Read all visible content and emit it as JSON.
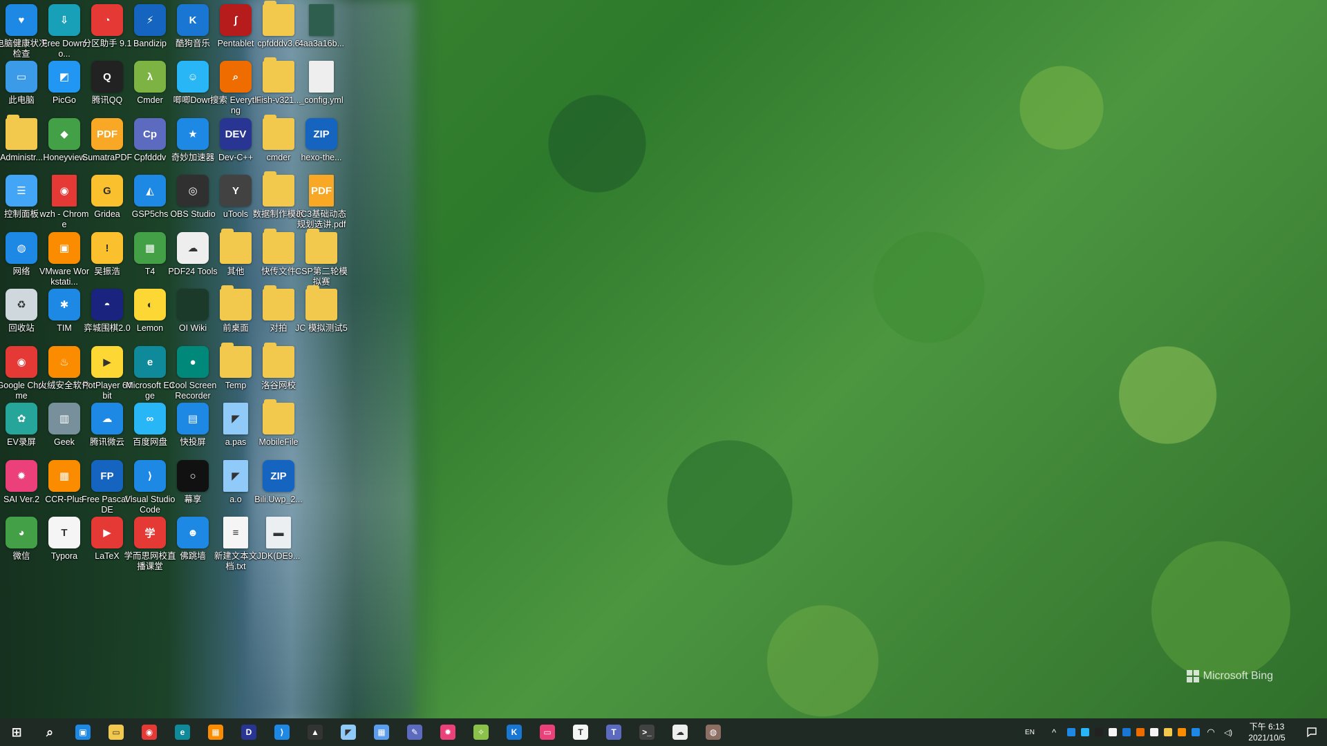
{
  "desktop": {
    "icons": [
      {
        "label": "电脑健康状况检查",
        "icon": "heart-health-icon",
        "color": "#1e88e5",
        "glyph": "♥"
      },
      {
        "label": "Free Downlo...",
        "icon": "download-manager-icon",
        "color": "#18a0b8",
        "glyph": "⇩"
      },
      {
        "label": "分区助手 9.1",
        "icon": "partition-assistant-icon",
        "color": "#e53935",
        "glyph": "◔"
      },
      {
        "label": "Bandizip",
        "icon": "bandizip-icon",
        "color": "#1565c0",
        "glyph": "⚡"
      },
      {
        "label": "酷狗音乐",
        "icon": "kugou-music-icon",
        "color": "#1976d2",
        "glyph": "K"
      },
      {
        "label": "Pentablet",
        "icon": "pentablet-icon",
        "color": "#b71c1c",
        "glyph": "∫"
      },
      {
        "label": "cpfdddv3.6",
        "icon": "folder-icon",
        "color": "#f2c94c",
        "glyph": ""
      },
      {
        "label": "4aa3a16b...",
        "icon": "image-file-icon",
        "color": "#2e5e4e",
        "glyph": ""
      },
      {
        "label": "此电脑",
        "icon": "this-pc-icon",
        "color": "#3b9be8",
        "glyph": "▭"
      },
      {
        "label": "PicGo",
        "icon": "picgo-icon",
        "color": "#2196f3",
        "glyph": "◩"
      },
      {
        "label": "腾讯QQ",
        "icon": "qq-penguin-icon",
        "color": "#222222",
        "glyph": "Q"
      },
      {
        "label": "Cmder",
        "icon": "cmder-lambda-icon",
        "color": "#7cb342",
        "glyph": "λ"
      },
      {
        "label": "唧唧Down",
        "icon": "jijidown-icon",
        "color": "#29b6f6",
        "glyph": "☺"
      },
      {
        "label": "搜索 Everything",
        "icon": "everything-search-icon",
        "color": "#ef6c00",
        "glyph": "⌕"
      },
      {
        "label": "Fish-v321...",
        "icon": "folder-icon",
        "color": "#f2c94c",
        "glyph": ""
      },
      {
        "label": "_config.yml",
        "icon": "file-icon",
        "color": "#eeeeee",
        "glyph": ""
      },
      {
        "label": "Administr...",
        "icon": "user-folder-icon",
        "color": "#f2c94c",
        "glyph": ""
      },
      {
        "label": "Honeyview",
        "icon": "honeyview-icon",
        "color": "#43a047",
        "glyph": "◆"
      },
      {
        "label": "SumatraPDF",
        "icon": "sumatrapdf-icon",
        "color": "#f9a825",
        "glyph": "PDF"
      },
      {
        "label": "Cpfdddv",
        "icon": "cpfdddv-icon",
        "color": "#5c6bc0",
        "glyph": "Cp"
      },
      {
        "label": "奇妙加速器",
        "icon": "accelerator-star-icon",
        "color": "#1e88e5",
        "glyph": "★"
      },
      {
        "label": "Dev-C++",
        "icon": "devcpp-icon",
        "color": "#283593",
        "glyph": "DEV"
      },
      {
        "label": "cmder",
        "icon": "folder-icon",
        "color": "#f2c94c",
        "glyph": ""
      },
      {
        "label": "hexo-the...",
        "icon": "zip-archive-icon",
        "color": "#1565c0",
        "glyph": "ZIP"
      },
      {
        "label": "控制面板",
        "icon": "control-panel-icon",
        "color": "#42a5f5",
        "glyph": "☰"
      },
      {
        "label": "wzh - Chrome",
        "icon": "chrome-profile-icon",
        "color": "#e53935",
        "glyph": "◉"
      },
      {
        "label": "Gridea",
        "icon": "gridea-icon",
        "color": "#fbc02d",
        "glyph": "G"
      },
      {
        "label": "GSP5chs",
        "icon": "geometer-sketchpad-icon",
        "color": "#1e88e5",
        "glyph": "◭"
      },
      {
        "label": "OBS Studio",
        "icon": "obs-studio-icon",
        "color": "#303030",
        "glyph": "◎"
      },
      {
        "label": "uTools",
        "icon": "utools-icon",
        "color": "#424242",
        "glyph": "Y"
      },
      {
        "label": "数据制作模板",
        "icon": "folder-icon",
        "color": "#f2c94c",
        "glyph": ""
      },
      {
        "label": "JC3基础动态规划选讲.pdf",
        "icon": "pdf-file-icon",
        "color": "#f9a825",
        "glyph": "PDF"
      },
      {
        "label": "网络",
        "icon": "network-globe-icon",
        "color": "#1e88e5",
        "glyph": "◍"
      },
      {
        "label": "VMware Workstati...",
        "icon": "vmware-icon",
        "color": "#fb8c00",
        "glyph": "▣"
      },
      {
        "label": "吴振浩",
        "icon": "warning-triangle-icon",
        "color": "#fbc02d",
        "glyph": "!"
      },
      {
        "label": "T4",
        "icon": "t4-tiles-icon",
        "color": "#43a047",
        "glyph": "▦"
      },
      {
        "label": "PDF24 Tools",
        "icon": "pdf24-sheep-icon",
        "color": "#eeeeee",
        "glyph": "☁"
      },
      {
        "label": "其他",
        "icon": "folder-icon",
        "color": "#f2c94c",
        "glyph": ""
      },
      {
        "label": "快传文件",
        "icon": "folder-icon",
        "color": "#f2c94c",
        "glyph": ""
      },
      {
        "label": "CSP第二轮模拟赛",
        "icon": "folder-icon",
        "color": "#f2c94c",
        "glyph": ""
      },
      {
        "label": "回收站",
        "icon": "recycle-bin-icon",
        "color": "#cfd8dc",
        "glyph": "♻"
      },
      {
        "label": "TIM",
        "icon": "tim-star-icon",
        "color": "#1e88e5",
        "glyph": "✱"
      },
      {
        "label": "弈城围棋2.0",
        "icon": "go-game-icon",
        "color": "#1a237e",
        "glyph": "◓"
      },
      {
        "label": "Lemon",
        "icon": "lemon-icon",
        "color": "#fdd835",
        "glyph": "◐"
      },
      {
        "label": "OI Wiki",
        "icon": "oi-wiki-icon",
        "color": "#1b3a2a",
        "glyph": ""
      },
      {
        "label": "前桌面",
        "icon": "folder-icon",
        "color": "#f2c94c",
        "glyph": ""
      },
      {
        "label": "对拍",
        "icon": "folder-icon",
        "color": "#f2c94c",
        "glyph": ""
      },
      {
        "label": "JC 模拟测试5",
        "icon": "folder-icon",
        "color": "#f2c94c",
        "glyph": ""
      },
      {
        "label": "Google Chrome",
        "icon": "chrome-icon",
        "color": "#e53935",
        "glyph": "◉"
      },
      {
        "label": "火绒安全软件",
        "icon": "huorong-flame-icon",
        "color": "#fb8c00",
        "glyph": "♨"
      },
      {
        "label": "PotPlayer 64 bit",
        "icon": "potplayer-icon",
        "color": "#fdd835",
        "glyph": "▶"
      },
      {
        "label": "Microsoft Edge",
        "icon": "edge-icon",
        "color": "#0f8a9a",
        "glyph": "e"
      },
      {
        "label": "Cool Screen Recorder",
        "icon": "screen-recorder-icon",
        "color": "#00897b",
        "glyph": "●"
      },
      {
        "label": "Temp",
        "icon": "folder-icon",
        "color": "#f2c94c",
        "glyph": ""
      },
      {
        "label": "洛谷网校",
        "icon": "folder-icon",
        "color": "#f2c94c",
        "glyph": ""
      },
      {
        "label": "EV录屏",
        "icon": "ev-recorder-icon",
        "color": "#26a69a",
        "glyph": "✿"
      },
      {
        "label": "Geek",
        "icon": "geek-uninstaller-icon",
        "color": "#78909c",
        "glyph": "▥"
      },
      {
        "label": "腾讯微云",
        "icon": "weiyun-cloud-icon",
        "color": "#1e88e5",
        "glyph": "☁"
      },
      {
        "label": "百度网盘",
        "icon": "baidu-netdisk-icon",
        "color": "#29b6f6",
        "glyph": "∞"
      },
      {
        "label": "快投屏",
        "icon": "screencast-icon",
        "color": "#1e88e5",
        "glyph": "▤"
      },
      {
        "label": "a.pas",
        "icon": "pascal-file-icon",
        "color": "#90caf9",
        "glyph": "◤"
      },
      {
        "label": "MobileFile",
        "icon": "folder-icon",
        "color": "#f2c94c",
        "glyph": ""
      },
      {
        "label": "SAI Ver.2",
        "icon": "sai-palette-icon",
        "color": "#ec407a",
        "glyph": "✹"
      },
      {
        "label": "CCR-Plus",
        "icon": "ccr-plus-icon",
        "color": "#fb8c00",
        "glyph": "▦"
      },
      {
        "label": "Free Pascal IDE",
        "icon": "free-pascal-icon",
        "color": "#1565c0",
        "glyph": "FP"
      },
      {
        "label": "Visual Studio Code",
        "icon": "vscode-icon",
        "color": "#1e88e5",
        "glyph": "⟩"
      },
      {
        "label": "幕享",
        "icon": "muxiang-icon",
        "color": "#111111",
        "glyph": "○"
      },
      {
        "label": "a.o",
        "icon": "object-file-icon",
        "color": "#90caf9",
        "glyph": "◤"
      },
      {
        "label": "Bili.Uwp_2...",
        "icon": "zip-archive-icon",
        "color": "#1565c0",
        "glyph": "ZIP"
      },
      {
        "label": "微信",
        "icon": "wechat-icon",
        "color": "#43a047",
        "glyph": "◕"
      },
      {
        "label": "Typora",
        "icon": "typora-icon",
        "color": "#f5f5f5",
        "glyph": "T"
      },
      {
        "label": "LaTeX",
        "icon": "latex-icon",
        "color": "#e53935",
        "glyph": "▶"
      },
      {
        "label": "学而思网校直播课堂",
        "icon": "xueersi-icon",
        "color": "#e53935",
        "glyph": "学"
      },
      {
        "label": "佛跳墙",
        "icon": "fotiaoqiang-icon",
        "color": "#1e88e5",
        "glyph": "☻"
      },
      {
        "label": "新建文本文档.txt",
        "icon": "text-file-icon",
        "color": "#f5f5f5",
        "glyph": "≡"
      },
      {
        "label": "JDK(DE9...",
        "icon": "installer-file-icon",
        "color": "#eceff1",
        "glyph": "▬"
      }
    ]
  },
  "wallpaper": {
    "brand_text": "Microsoft Bing"
  },
  "taskbar": {
    "apps": [
      {
        "name": "start-button",
        "icon": "windows-start-icon",
        "color": "#ffffff",
        "glyph": "⊞"
      },
      {
        "name": "search-button",
        "icon": "search-icon",
        "color": "#ffffff",
        "glyph": "⌕"
      },
      {
        "name": "store-app",
        "icon": "store-bag-icon",
        "color": "#1e88e5",
        "glyph": "▣"
      },
      {
        "name": "file-explorer-app",
        "icon": "file-explorer-icon",
        "color": "#f2c94c",
        "glyph": "▭"
      },
      {
        "name": "chrome-app",
        "icon": "chrome-icon",
        "color": "#e53935",
        "glyph": "◉"
      },
      {
        "name": "edge-app",
        "icon": "edge-icon",
        "color": "#0f8a9a",
        "glyph": "e"
      },
      {
        "name": "office-app",
        "icon": "office-tiles-icon",
        "color": "#fb8c00",
        "glyph": "▦"
      },
      {
        "name": "devcpp-app",
        "icon": "devcpp-icon",
        "color": "#283593",
        "glyph": "D"
      },
      {
        "name": "vscode-app",
        "icon": "vscode-icon",
        "color": "#1e88e5",
        "glyph": "⟩"
      },
      {
        "name": "classroom-app",
        "icon": "graduation-cap-icon",
        "color": "#333333",
        "glyph": "▲"
      },
      {
        "name": "notes-app",
        "icon": "notes-icon",
        "color": "#90caf9",
        "glyph": "◤"
      },
      {
        "name": "calculator-app",
        "icon": "calculator-icon",
        "color": "#5c9ded",
        "glyph": "▦"
      },
      {
        "name": "pen-app",
        "icon": "pen-icon",
        "color": "#5c6bc0",
        "glyph": "✎"
      },
      {
        "name": "sai-app",
        "icon": "sai-palette-icon",
        "color": "#ec407a",
        "glyph": "✹"
      },
      {
        "name": "chat-app",
        "icon": "chat-bird-icon",
        "color": "#8bc34a",
        "glyph": "✧"
      },
      {
        "name": "kugou-app",
        "icon": "kugou-music-icon",
        "color": "#1976d2",
        "glyph": "K"
      },
      {
        "name": "bilibili-app",
        "icon": "bilibili-tv-icon",
        "color": "#ec407a",
        "glyph": "▭"
      },
      {
        "name": "typora-app",
        "icon": "typora-icon",
        "color": "#f5f5f5",
        "glyph": "T"
      },
      {
        "name": "teams-app",
        "icon": "teams-icon",
        "color": "#5c6bc0",
        "glyph": "T"
      },
      {
        "name": "terminal-app",
        "icon": "terminal-icon",
        "color": "#424242",
        "glyph": ">_"
      },
      {
        "name": "pdf24-app",
        "icon": "pdf24-sheep-icon",
        "color": "#eeeeee",
        "glyph": "☁"
      },
      {
        "name": "owl-app",
        "icon": "owl-icon",
        "color": "#8d6e63",
        "glyph": "◍"
      }
    ],
    "tray": {
      "input_indicator": "EN",
      "overflow_glyph": "^",
      "icons": [
        {
          "icon": "tray-app-blue-icon",
          "color": "#1e88e5"
        },
        {
          "icon": "tray-app-cyan-icon",
          "color": "#29b6f6"
        },
        {
          "icon": "tray-qq-icon",
          "color": "#222222"
        },
        {
          "icon": "tray-shield-icon",
          "color": "#f5f5f5"
        },
        {
          "icon": "tray-kugou-icon",
          "color": "#1976d2"
        },
        {
          "icon": "tray-everything-icon",
          "color": "#ef6c00"
        },
        {
          "icon": "tray-pin-icon",
          "color": "#f5f5f5"
        },
        {
          "icon": "tray-folder-icon",
          "color": "#f2c94c"
        },
        {
          "icon": "tray-security-icon",
          "color": "#fb8c00"
        },
        {
          "icon": "tray-bluetooth-icon",
          "color": "#1e88e5"
        }
      ],
      "wifi_glyph": "◠",
      "volume_glyph": "◁)",
      "time": "下午 6:13",
      "date": "2021/10/5"
    }
  }
}
